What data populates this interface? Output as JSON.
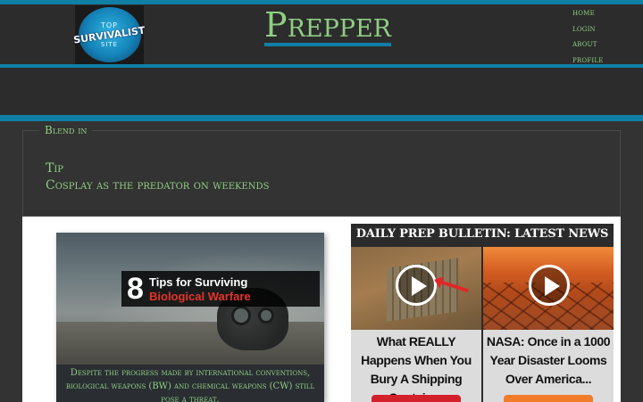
{
  "header": {
    "logo": {
      "top_text": "TOP",
      "main_text": "SURVIVALIST",
      "bottom_text": "SITE"
    },
    "brand": "Prepper",
    "nav": [
      "HOME",
      "LOGIN",
      "ABOUT",
      "PROFILE"
    ]
  },
  "tip_box": {
    "legend": "Blend in",
    "label": "Tip",
    "text": "Cosplay as the predator on weekends"
  },
  "article": {
    "number": "8",
    "title_line1": "Tips for Surviving",
    "title_line2": "Biological Warfare",
    "caption": "Despite the progress made by international conventions, biological weapons (BW) and chemical weapons (CW) still pose a threat."
  },
  "bulletin": {
    "title": "DAILY PREP BULLETIN: LATEST NEWS",
    "items": [
      {
        "text": "What REALLY Happens When You Bury A Shipping Container",
        "icon": "play-icon"
      },
      {
        "text": "NASA: Once in a 1000 Year Disaster Looms Over America...",
        "icon": "play-icon"
      }
    ]
  },
  "colors": {
    "accent_blue": "#0f7fa6",
    "text_green": "#8fce83",
    "background": "#333333",
    "watch_red": "#d4202a",
    "watch_orange": "#f07c2a"
  }
}
